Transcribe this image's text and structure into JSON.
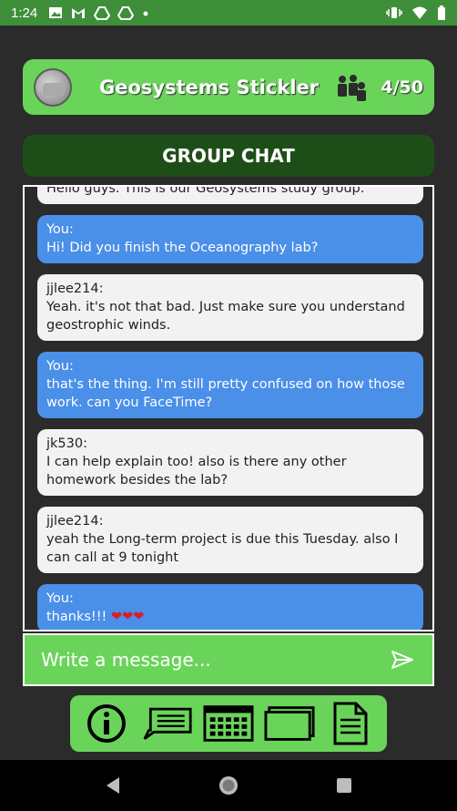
{
  "status_bar": {
    "time": "1:24",
    "icons": [
      "image-icon",
      "gmail-icon",
      "drive-icon",
      "drive-icon",
      "dot-icon"
    ],
    "right_icons": [
      "vibrate-icon",
      "wifi-icon",
      "battery-icon"
    ]
  },
  "header": {
    "group_name": "Geosystems Stickler",
    "member_count": "4/50",
    "members_icon": "members-icon"
  },
  "chat": {
    "title": "GROUP CHAT",
    "messages": [
      {
        "sender": "",
        "text": "Hello guys. This is our Geosystems study group.",
        "self": false
      },
      {
        "sender": "You:",
        "text": "Hi! Did you finish the Oceanography lab?",
        "self": true
      },
      {
        "sender": "jjlee214:",
        "text": "Yeah. it's not that bad. Just make sure you understand geostrophic winds.",
        "self": false
      },
      {
        "sender": "You:",
        "text": "that's the thing. I'm still pretty confused on how those work. can you FaceTime?",
        "self": true
      },
      {
        "sender": "jk530:",
        "text": "I can help explain too! also is there any other homework besides the lab?",
        "self": false
      },
      {
        "sender": "jjlee214:",
        "text": "yeah the Long-term project is due this Tuesday. also I can call at 9 tonight",
        "self": false
      },
      {
        "sender": "You:",
        "text": "thanks!!! ",
        "hearts": "❤❤❤",
        "self": true
      }
    ]
  },
  "composer": {
    "placeholder": "Write a message...",
    "send_icon": "send-icon"
  },
  "toolbar": {
    "items": [
      "info-icon",
      "chat-icon",
      "calendar-icon",
      "cards-icon",
      "document-icon"
    ]
  },
  "navbar": {
    "items": [
      "back-icon",
      "home-icon",
      "recents-icon"
    ]
  },
  "colors": {
    "status_bar": "#3f8f3a",
    "accent_green": "#6ad45a",
    "dark_green": "#1e4e18",
    "self_bubble": "#4a8fe8",
    "other_bubble": "#f2f2f2",
    "background": "#2b2b2b"
  }
}
